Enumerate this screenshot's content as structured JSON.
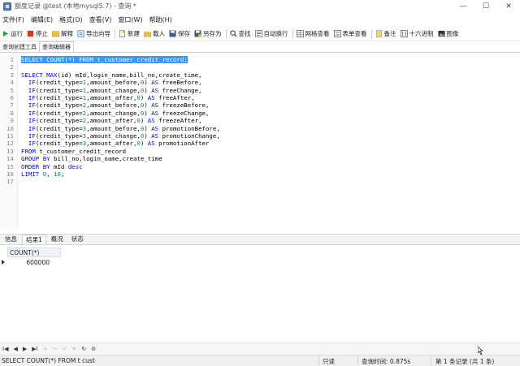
{
  "window": {
    "title": "额度记录 @test (本地mysql5.7) - 查询 *",
    "minimize": "—",
    "maximize": "☐",
    "close": "✕"
  },
  "menu": [
    "文件(F)",
    "编辑(E)",
    "格式(O)",
    "查看(V)",
    "窗口(W)",
    "帮助(H)"
  ],
  "toolbar": {
    "run": "运行",
    "stop": "停止",
    "explain": "解释",
    "export_wizard": "导出向导",
    "new": "新建",
    "load": "载入",
    "save": "保存",
    "save_as": "另存为",
    "find": "查找",
    "autowrap": "自动换行",
    "grid_view": "网格查看",
    "form_view": "表单查看",
    "memo": "备注",
    "hex": "十六进制",
    "image": "图像"
  },
  "editor_tabs": [
    "查询创建工具",
    "查询编辑器"
  ],
  "editor": {
    "line_numbers": [
      "1",
      "2",
      "3",
      "4",
      "5",
      "6",
      "7",
      "8",
      "9",
      "10",
      "11",
      "12",
      "13",
      "14",
      "15",
      "16",
      "17"
    ],
    "lines": [
      "SELECT COUNT(*) FROM t_customer_credit_record;",
      "",
      "SELECT MAX(id) mId,login_name,bill_no,create_time,",
      "  IF(credit_type=1,amount_before,0) AS freeBefore,",
      "  IF(credit_type=1,amount_change,0) AS freeChange,",
      "  IF(credit_type=1,amount_after,0) AS freeAfter,",
      "  IF(credit_type=2,amount_before,0) AS freezeBefore,",
      "  IF(credit_type=2,amount_change,0) AS freezeChange,",
      "  IF(credit_type=2,amount_after,0) AS freezeAfter,",
      "  IF(credit_type=3,amount_before,0) AS promotionBefore,",
      "  IF(credit_type=3,amount_change,0) AS promotionChange,",
      "  IF(credit_type=3,amount_after,0) AS promotionAfter",
      "FROM t_customer_credit_record",
      "GROUP BY bill_no,login_name,create_time",
      "ORDER BY mId desc",
      "LIMIT 0, 10;",
      ""
    ]
  },
  "result_tabs": [
    "信息",
    "结果1",
    "概况",
    "状态"
  ],
  "grid": {
    "column": "COUNT(*)",
    "value": "600000"
  },
  "nav": [
    "I◀",
    "◀",
    "▶",
    "▶I",
    "+",
    "−",
    "✓",
    "✕",
    "↻",
    "⊘"
  ],
  "status": {
    "sql": "SELECT COUNT(*) FROM t cust",
    "readonly": "只读",
    "query_time": "查询时间: 0.875s",
    "records": "第 1 条记录 (共 1 条)"
  },
  "colors": {
    "selection": "#3399ff",
    "keyword": "#0000ff",
    "number": "#098658"
  }
}
